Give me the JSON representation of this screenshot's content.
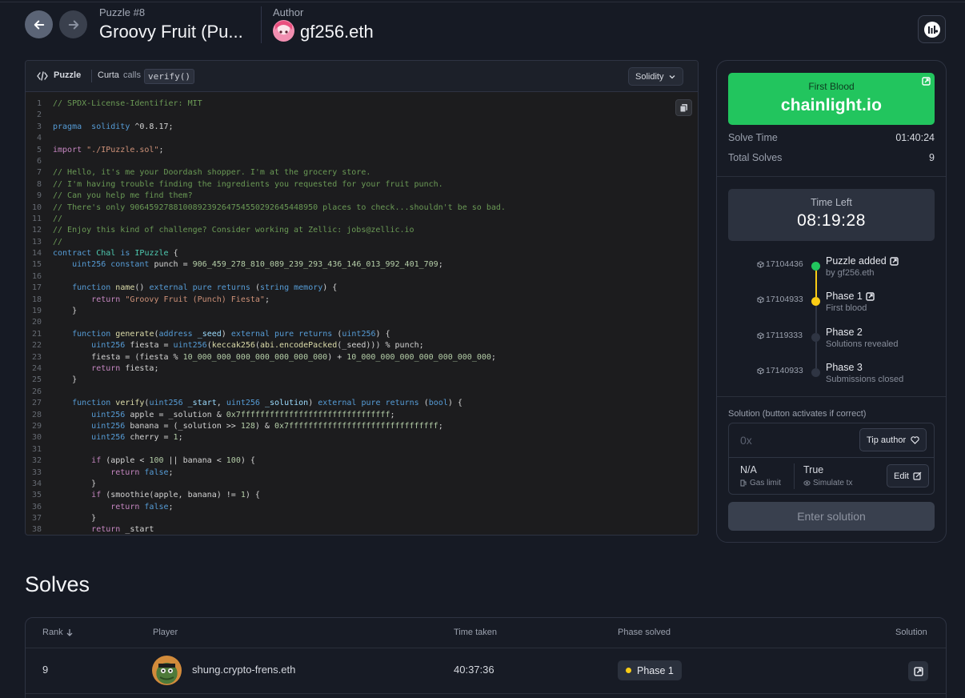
{
  "header": {
    "puzzle_label": "Puzzle #8",
    "puzzle_title": "Groovy Fruit (Pu...",
    "author_label": "Author",
    "author_name": "gf256.eth"
  },
  "code_panel": {
    "tab_label": "Puzzle",
    "caller": "Curta",
    "calls_word": "calls",
    "function_name": "verify()",
    "language": "Solidity",
    "lines": [
      [
        [
          "c-com",
          "// SPDX-License-Identifier: MIT"
        ]
      ],
      [],
      [
        [
          "c-kw",
          "pragma"
        ],
        [
          "",
          "  "
        ],
        [
          "c-kw",
          "solidity"
        ],
        [
          "",
          " ^0.8.17;"
        ]
      ],
      [],
      [
        [
          "c-ctl",
          "import"
        ],
        [
          "",
          " "
        ],
        [
          "c-str",
          "\"./IPuzzle.sol\""
        ],
        [
          "",
          ";"
        ]
      ],
      [],
      [
        [
          "c-com",
          "// Hello, it's me your Doordash shopper. I'm at the grocery store."
        ]
      ],
      [
        [
          "c-com",
          "// I'm having trouble finding the ingredients you requested for your fruit punch."
        ]
      ],
      [
        [
          "c-com",
          "// Can you help me find them?"
        ]
      ],
      [
        [
          "c-com",
          "// There's only 906459278810089239264754550292645448950 places to check...shouldn't be so bad."
        ]
      ],
      [
        [
          "c-com",
          "//"
        ]
      ],
      [
        [
          "c-com",
          "// Enjoy this kind of challenge? Consider working at Zellic: jobs@zellic.io"
        ]
      ],
      [
        [
          "c-com",
          "//"
        ]
      ],
      [
        [
          "c-kw",
          "contract"
        ],
        [
          "",
          " "
        ],
        [
          "c-type",
          "Chal"
        ],
        [
          "",
          " "
        ],
        [
          "c-kw",
          "is"
        ],
        [
          "",
          " "
        ],
        [
          "c-type",
          "IPuzzle"
        ],
        [
          "",
          " {"
        ]
      ],
      [
        [
          "",
          "    "
        ],
        [
          "c-kw",
          "uint256"
        ],
        [
          "",
          " "
        ],
        [
          "c-kw",
          "constant"
        ],
        [
          "",
          " punch = "
        ],
        [
          "c-num",
          "906_459_278_810_089_239_293_436_146_013_992_401_709"
        ],
        [
          "",
          ";"
        ]
      ],
      [],
      [
        [
          "",
          "    "
        ],
        [
          "c-kw",
          "function"
        ],
        [
          "",
          " "
        ],
        [
          "c-fn",
          "name"
        ],
        [
          "",
          "() "
        ],
        [
          "c-kw",
          "external"
        ],
        [
          "",
          " "
        ],
        [
          "c-kw",
          "pure"
        ],
        [
          "",
          " "
        ],
        [
          "c-kw",
          "returns"
        ],
        [
          "",
          " ("
        ],
        [
          "c-kw",
          "string"
        ],
        [
          "",
          " "
        ],
        [
          "c-kw",
          "memory"
        ],
        [
          "",
          ") {"
        ]
      ],
      [
        [
          "",
          "        "
        ],
        [
          "c-ctl",
          "return"
        ],
        [
          "",
          " "
        ],
        [
          "c-str",
          "\"Groovy Fruit (Punch) Fiesta\""
        ],
        [
          "",
          ";"
        ]
      ],
      [
        [
          "",
          "    }"
        ]
      ],
      [],
      [
        [
          "",
          "    "
        ],
        [
          "c-kw",
          "function"
        ],
        [
          "",
          " "
        ],
        [
          "c-fn",
          "generate"
        ],
        [
          "",
          "("
        ],
        [
          "c-kw",
          "address"
        ],
        [
          "",
          " "
        ],
        [
          "c-var",
          "_seed"
        ],
        [
          "",
          ") "
        ],
        [
          "c-kw",
          "external"
        ],
        [
          "",
          " "
        ],
        [
          "c-kw",
          "pure"
        ],
        [
          "",
          " "
        ],
        [
          "c-kw",
          "returns"
        ],
        [
          "",
          " ("
        ],
        [
          "c-kw",
          "uint256"
        ],
        [
          "",
          ") {"
        ]
      ],
      [
        [
          "",
          "        "
        ],
        [
          "c-kw",
          "uint256"
        ],
        [
          "",
          " fiesta = "
        ],
        [
          "c-kw",
          "uint256"
        ],
        [
          "",
          "("
        ],
        [
          "c-fn",
          "keccak256"
        ],
        [
          "",
          "("
        ],
        [
          "c-fn",
          "abi.encodePacked"
        ],
        [
          "",
          "(_seed))) % punch;"
        ]
      ],
      [
        [
          "",
          "        fiesta = (fiesta % "
        ],
        [
          "c-num",
          "10_000_000_000_000_000_000_000"
        ],
        [
          "",
          ") + "
        ],
        [
          "c-num",
          "10_000_000_000_000_000_000_000"
        ],
        [
          "",
          ";"
        ]
      ],
      [
        [
          "",
          "        "
        ],
        [
          "c-ctl",
          "return"
        ],
        [
          "",
          " fiesta;"
        ]
      ],
      [
        [
          "",
          "    }"
        ]
      ],
      [],
      [
        [
          "",
          "    "
        ],
        [
          "c-kw",
          "function"
        ],
        [
          "",
          " "
        ],
        [
          "c-fn",
          "verify"
        ],
        [
          "",
          "("
        ],
        [
          "c-kw",
          "uint256"
        ],
        [
          "",
          " "
        ],
        [
          "c-var",
          "_start"
        ],
        [
          "",
          ", "
        ],
        [
          "c-kw",
          "uint256"
        ],
        [
          "",
          " "
        ],
        [
          "c-var",
          "_solution"
        ],
        [
          "",
          ") "
        ],
        [
          "c-kw",
          "external"
        ],
        [
          "",
          " "
        ],
        [
          "c-kw",
          "pure"
        ],
        [
          "",
          " "
        ],
        [
          "c-kw",
          "returns"
        ],
        [
          "",
          " ("
        ],
        [
          "c-kw",
          "bool"
        ],
        [
          "",
          ") {"
        ]
      ],
      [
        [
          "",
          "        "
        ],
        [
          "c-kw",
          "uint256"
        ],
        [
          "",
          " apple = _solution & "
        ],
        [
          "c-num",
          "0x7fffffffffffffffffffffffffffffff"
        ],
        [
          "",
          ";"
        ]
      ],
      [
        [
          "",
          "        "
        ],
        [
          "c-kw",
          "uint256"
        ],
        [
          "",
          " banana = (_solution >> "
        ],
        [
          "c-num",
          "128"
        ],
        [
          "",
          ") & "
        ],
        [
          "c-num",
          "0x7fffffffffffffffffffffffffffffff"
        ],
        [
          "",
          ";"
        ]
      ],
      [
        [
          "",
          "        "
        ],
        [
          "c-kw",
          "uint256"
        ],
        [
          "",
          " cherry = "
        ],
        [
          "c-num",
          "1"
        ],
        [
          "",
          ";"
        ]
      ],
      [],
      [
        [
          "",
          "        "
        ],
        [
          "c-ctl",
          "if"
        ],
        [
          "",
          " (apple < "
        ],
        [
          "c-num",
          "100"
        ],
        [
          "",
          " || banana < "
        ],
        [
          "c-num",
          "100"
        ],
        [
          "",
          ") {"
        ]
      ],
      [
        [
          "",
          "            "
        ],
        [
          "c-ctl",
          "return"
        ],
        [
          "",
          " "
        ],
        [
          "c-kw",
          "false"
        ],
        [
          "",
          ";"
        ]
      ],
      [
        [
          "",
          "        }"
        ]
      ],
      [
        [
          "",
          "        "
        ],
        [
          "c-ctl",
          "if"
        ],
        [
          "",
          " (smoothie(apple, banana) != "
        ],
        [
          "c-num",
          "1"
        ],
        [
          "",
          ") {"
        ]
      ],
      [
        [
          "",
          "            "
        ],
        [
          "c-ctl",
          "return"
        ],
        [
          "",
          " "
        ],
        [
          "c-kw",
          "false"
        ],
        [
          "",
          ";"
        ]
      ],
      [
        [
          "",
          "        }"
        ]
      ],
      [
        [
          "",
          "        "
        ],
        [
          "c-ctl",
          "return"
        ],
        [
          "",
          " _start"
        ]
      ]
    ]
  },
  "side": {
    "first_blood_label": "First Blood",
    "first_blood_name": "chainlight.io",
    "solve_time_label": "Solve Time",
    "solve_time_value": "01:40:24",
    "total_solves_label": "Total Solves",
    "total_solves_value": "9",
    "time_left_label": "Time Left",
    "time_left_value": "08:19:28",
    "timeline": [
      {
        "block": "17104436",
        "title": "Puzzle added",
        "sub": "by gf256.eth",
        "color": "#22c55e",
        "link": true
      },
      {
        "block": "17104933",
        "title": "Phase 1",
        "sub": "First blood",
        "color": "#facc15",
        "link": true
      },
      {
        "block": "17119333",
        "title": "Phase 2",
        "sub": "Solutions revealed",
        "color": "#2f3543",
        "link": false
      },
      {
        "block": "17140933",
        "title": "Phase 3",
        "sub": "Submissions closed",
        "color": "#2f3543",
        "link": false
      }
    ],
    "solution_label": "Solution (button activates if correct)",
    "solution_placeholder": "0x",
    "tip_author_label": "Tip author",
    "gas_value": "N/A",
    "gas_label": "Gas limit",
    "simulate_value": "True",
    "simulate_label": "Simulate tx",
    "edit_label": "Edit",
    "enter_label": "Enter solution"
  },
  "solves": {
    "title": "Solves",
    "columns": [
      "Rank",
      "Player",
      "Time taken",
      "Phase solved",
      "Solution"
    ],
    "rows": [
      {
        "rank": "9",
        "player": "shung.crypto-frens.eth",
        "time": "40:37:36",
        "phase": "Phase 1",
        "phase_color": "#facc15"
      }
    ]
  }
}
